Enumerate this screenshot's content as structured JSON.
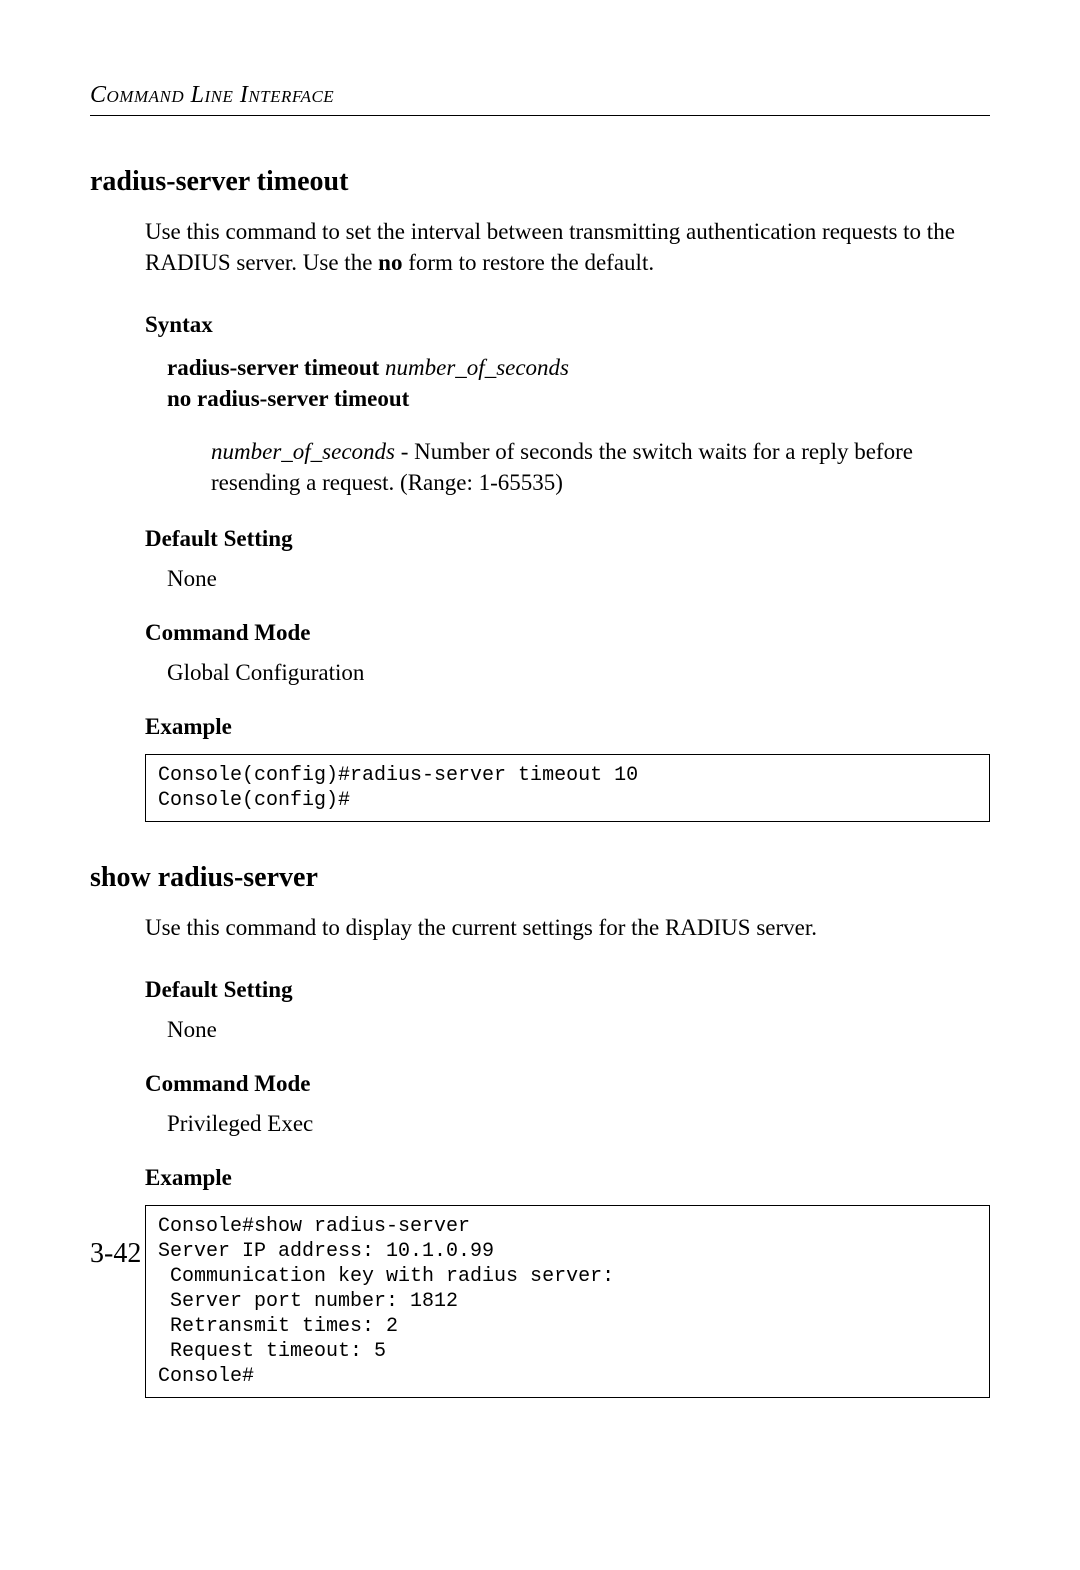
{
  "header": {
    "running_head": "Command Line Interface"
  },
  "cmd1": {
    "title": "radius-server timeout",
    "desc_a": "Use this command to set the interval between transmitting authentication requests to the RADIUS server. Use the ",
    "desc_b_bold": "no",
    "desc_c": " form to restore the default.",
    "syntax_label": "Syntax",
    "syntax_line1_bold": "radius-server timeout ",
    "syntax_line1_ital": "number_of_seconds",
    "syntax_line2_bold": "no radius-server timeout",
    "param_ital": "number_of_seconds",
    "param_rest": " - Number of seconds the switch waits for a reply before resending a request. (Range: 1-65535)",
    "default_label": "Default Setting",
    "default_value": "None",
    "mode_label": "Command Mode",
    "mode_value": "Global Configuration",
    "example_label": "Example",
    "example_text": "Console(config)#radius-server timeout 10\nConsole(config)#"
  },
  "cmd2": {
    "title": "show radius-server",
    "desc": "Use this command to display the current settings for the RADIUS server.",
    "default_label": "Default Setting",
    "default_value": "None",
    "mode_label": "Command Mode",
    "mode_value": "Privileged Exec",
    "example_label": "Example",
    "example_text": "Console#show radius-server\nServer IP address: 10.1.0.99\n Communication key with radius server:\n Server port number: 1812\n Retransmit times: 2\n Request timeout: 5\nConsole#"
  },
  "footer": {
    "page_num": "3-42"
  }
}
